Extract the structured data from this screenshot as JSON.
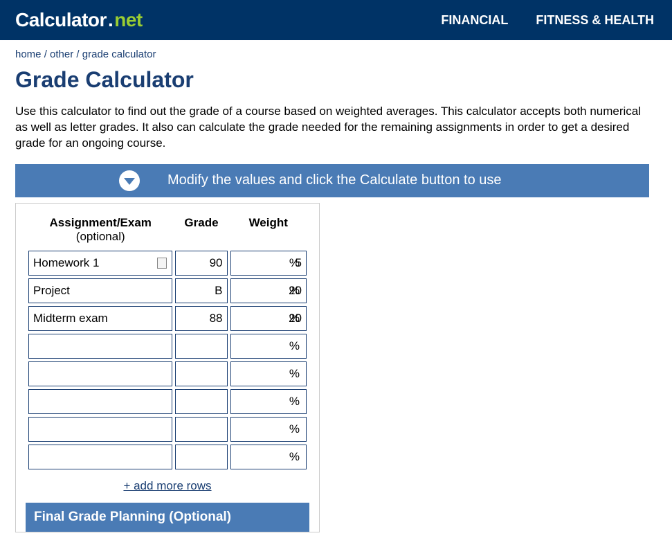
{
  "logo": {
    "main": "Calculator",
    "dot": ".",
    "net": "net"
  },
  "nav": {
    "financial": "FINANCIAL",
    "fitness": "FITNESS & HEALTH"
  },
  "breadcrumb": {
    "home": "home",
    "sep": " / ",
    "other": "other",
    "current": "grade calculator"
  },
  "page_title": "Grade Calculator",
  "intro": "Use this calculator to find out the grade of a course based on weighted averages. This calculator accepts both numerical as well as letter grades. It also can calculate the grade needed for the remaining assignments in order to get a desired grade for an ongoing course.",
  "banner_text": "Modify the values and click the Calculate button to use",
  "headers": {
    "assignment": "Assignment/Exam",
    "assignment_sub": "(optional)",
    "grade": "Grade",
    "weight": "Weight"
  },
  "rows": [
    {
      "name": "Homework 1",
      "grade": "90",
      "weight": "5"
    },
    {
      "name": "Project",
      "grade": "B",
      "weight": "20"
    },
    {
      "name": "Midterm exam",
      "grade": "88",
      "weight": "20"
    },
    {
      "name": "",
      "grade": "",
      "weight": ""
    },
    {
      "name": "",
      "grade": "",
      "weight": ""
    },
    {
      "name": "",
      "grade": "",
      "weight": ""
    },
    {
      "name": "",
      "grade": "",
      "weight": ""
    },
    {
      "name": "",
      "grade": "",
      "weight": ""
    }
  ],
  "add_rows": "+ add more rows",
  "final_planning": "Final Grade Planning (Optional)",
  "pct": "%"
}
